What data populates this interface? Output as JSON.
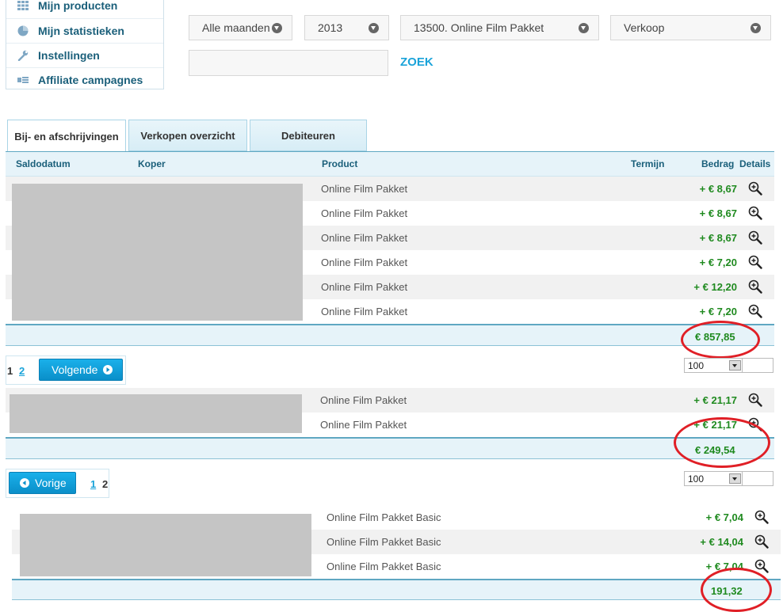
{
  "sidebar": {
    "items": [
      {
        "label": "Mijn producten",
        "icon": "grid-icon"
      },
      {
        "label": "Mijn statistieken",
        "icon": "pie-chart-icon"
      },
      {
        "label": "Instellingen",
        "icon": "wrench-icon"
      },
      {
        "label": "Affiliate campagnes",
        "icon": "campaign-icon"
      }
    ]
  },
  "filters": {
    "month": "Alle maanden",
    "year": "2013",
    "product": "13500. Online Film Pakket",
    "type": "Verkoop",
    "search_value": "",
    "search_button": "ZOEK"
  },
  "tabs": [
    {
      "label": "Bij- en afschrijvingen",
      "active": true
    },
    {
      "label": "Verkopen overzicht",
      "active": false
    },
    {
      "label": "Debiteuren",
      "active": false
    }
  ],
  "table": {
    "columns": [
      "Saldodatum",
      "Koper",
      "Product",
      "Termijn",
      "Bedrag",
      "Details"
    ]
  },
  "section1": {
    "rows": [
      {
        "product": "Online Film Pakket",
        "amount": "+ € 8,67"
      },
      {
        "product": "Online Film Pakket",
        "amount": "+ € 8,67"
      },
      {
        "product": "Online Film Pakket",
        "amount": "+ € 8,67"
      },
      {
        "product": "Online Film Pakket",
        "amount": "+ € 7,20"
      },
      {
        "product": "Online Film Pakket",
        "amount": "+ € 12,20"
      },
      {
        "product": "Online Film Pakket",
        "amount": "+ € 7,20"
      }
    ],
    "total": "€ 857,85"
  },
  "pager1": {
    "current": "1",
    "link": "2",
    "next_label": "Volgende",
    "per_page": "100"
  },
  "section2": {
    "rows": [
      {
        "product": "Online Film Pakket",
        "amount": "+ € 21,17"
      },
      {
        "product": "Online Film Pakket",
        "amount": "+ € 21,17"
      }
    ],
    "total": "€ 249,54"
  },
  "pager2": {
    "prev_label": "Vorige",
    "link": "1",
    "current": "2",
    "per_page": "100"
  },
  "section3": {
    "rows": [
      {
        "product": "Online Film Pakket Basic",
        "amount": "+ € 7,04"
      },
      {
        "product": "Online Film Pakket Basic",
        "amount": "+ € 14,04"
      },
      {
        "product": "Online Film Pakket Basic",
        "amount": "+ € 7,04"
      }
    ],
    "total": "191,32"
  },
  "colors": {
    "accent": "#1aa3d9",
    "amount_green": "#1f8a1f",
    "header_text": "#1a5f7a",
    "annotation_red": "#e01f26"
  }
}
